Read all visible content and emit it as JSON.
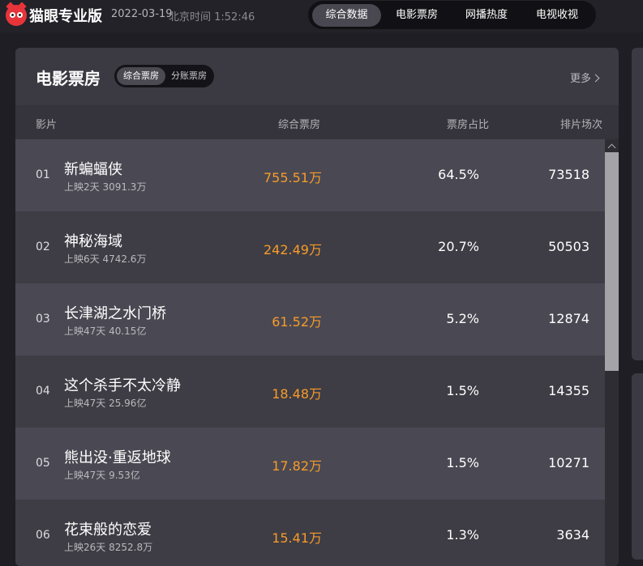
{
  "header": {
    "brand": "猫眼专业版",
    "date": "2022-03-19",
    "time": "北京时间 1:52:46",
    "tabs": [
      "综合数据",
      "电影票房",
      "网播热度",
      "电视收视"
    ],
    "active_tab": "综合数据"
  },
  "card": {
    "title": "电影票房",
    "toggle": [
      "综合票房",
      "分账票房"
    ],
    "active_toggle": "综合票房",
    "more": "更多",
    "columns": {
      "movie": "影片",
      "box": "综合票房",
      "share": "票房占比",
      "shows": "排片场次"
    },
    "rows": [
      {
        "rank": "01",
        "name": "新蝙蝠侠",
        "info": "上映2天  3091.3万",
        "box": "755.51万",
        "share": "64.5%",
        "shows": "73518"
      },
      {
        "rank": "02",
        "name": "神秘海域",
        "info": "上映6天  4742.6万",
        "box": "242.49万",
        "share": "20.7%",
        "shows": "50503"
      },
      {
        "rank": "03",
        "name": "长津湖之水门桥",
        "info": "上映47天  40.15亿",
        "box": "61.52万",
        "share": "5.2%",
        "shows": "12874"
      },
      {
        "rank": "04",
        "name": "这个杀手不太冷静",
        "info": "上映47天  25.96亿",
        "box": "18.48万",
        "share": "1.5%",
        "shows": "14355"
      },
      {
        "rank": "05",
        "name": "熊出没·重返地球",
        "info": "上映47天  9.53亿",
        "box": "17.82万",
        "share": "1.5%",
        "shows": "10271"
      },
      {
        "rank": "06",
        "name": "花束般的恋爱",
        "info": "上映26天  8252.8万",
        "box": "15.41万",
        "share": "1.3%",
        "shows": "3634"
      }
    ]
  },
  "colors": {
    "accent_box": "#f79b2a",
    "logo_red": "#e7343b",
    "background": "#1f1e24",
    "card": "#3b3a43"
  },
  "icons": {
    "logo": "cat-eye-logo-icon",
    "more": "chevron-right-icon",
    "scroll": "chevron-up-icon"
  }
}
